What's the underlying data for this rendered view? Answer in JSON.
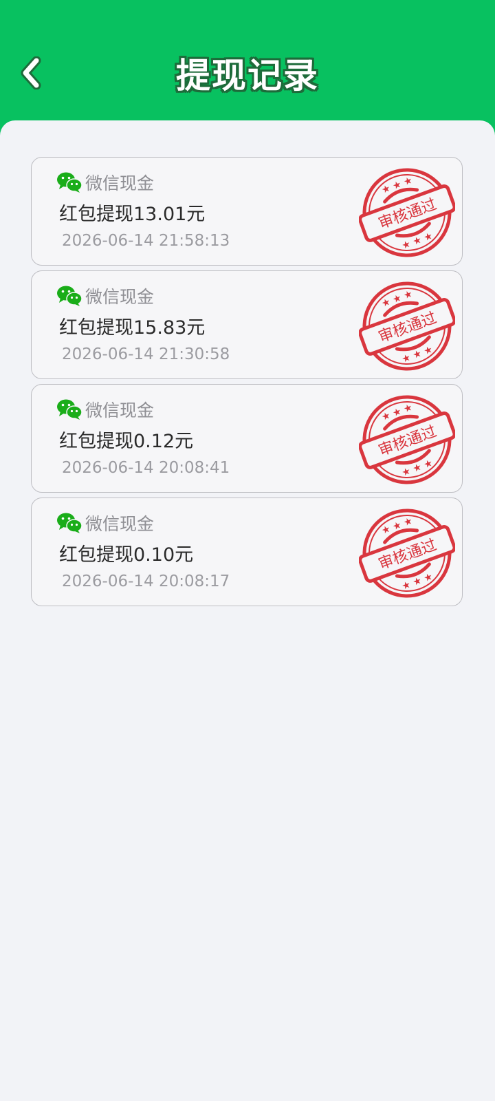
{
  "header": {
    "title": "提现记录",
    "back_icon": "chevron-left-icon",
    "bg_color": "#08c160"
  },
  "records": [
    {
      "type_icon": "wechat-icon",
      "type": "微信现金",
      "amount": "红包提现13.01元",
      "time": "2026-06-14 21:58:13",
      "status": "审核通过"
    },
    {
      "type_icon": "wechat-icon",
      "type": "微信现金",
      "amount": "红包提现15.83元",
      "time": "2026-06-14 21:30:58",
      "status": "审核通过"
    },
    {
      "type_icon": "wechat-icon",
      "type": "微信现金",
      "amount": "红包提现0.12元",
      "time": "2026-06-14 20:08:41",
      "status": "审核通过"
    },
    {
      "type_icon": "wechat-icon",
      "type": "微信现金",
      "amount": "红包提现0.10元",
      "time": "2026-06-14 20:08:17",
      "status": "审核通过"
    }
  ],
  "colors": {
    "wechat_green": "#1aad19",
    "stamp_red": "#d9363e"
  }
}
